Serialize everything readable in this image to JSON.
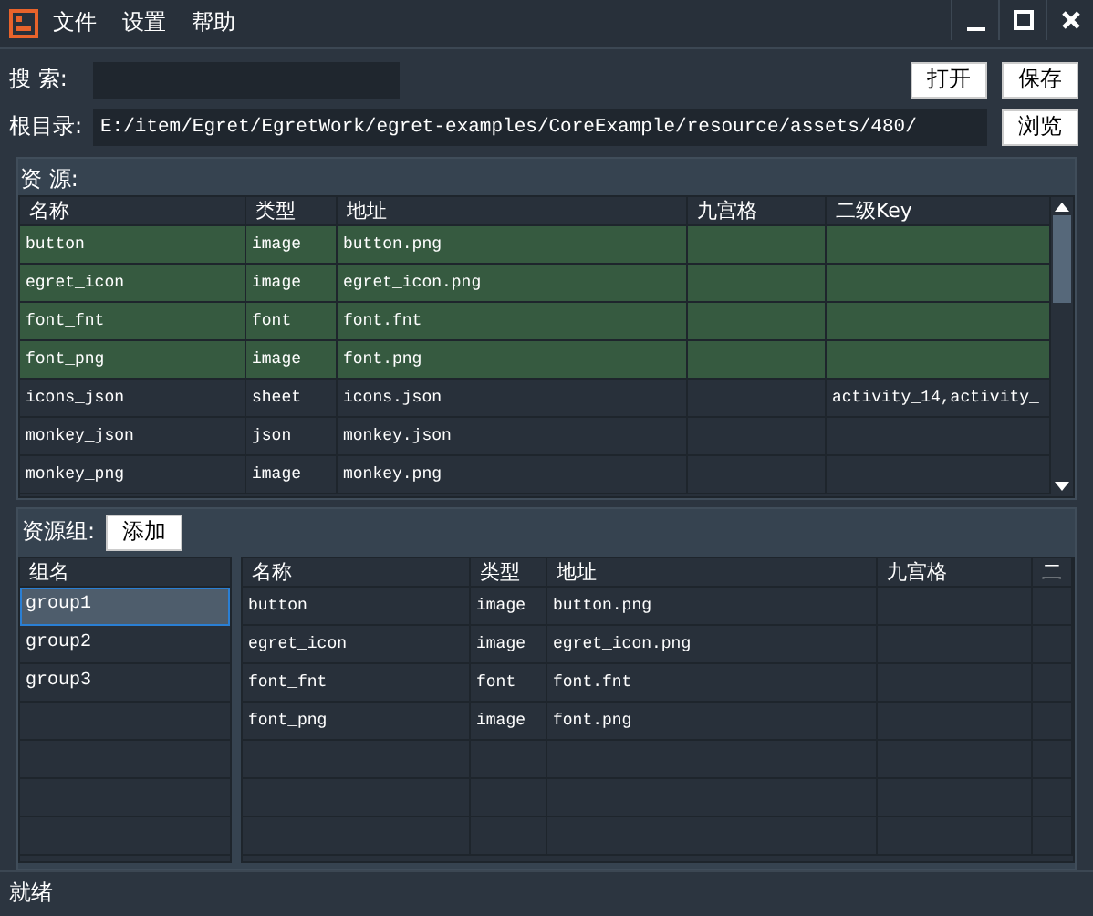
{
  "menu": [
    "文件",
    "设置",
    "帮助"
  ],
  "search": {
    "label": "搜  索:"
  },
  "buttons_top": [
    "打开",
    "保存"
  ],
  "root": {
    "label": "根目录:",
    "value": "E:/item/Egret/EgretWork/egret-examples/CoreExample/resource/assets/480/",
    "button": "浏览"
  },
  "resources": {
    "title": "资  源:",
    "columns": [
      "名称",
      "类型",
      "地址",
      "九宫格",
      "二级Key"
    ],
    "rows": [
      {
        "name": "button",
        "type": "image",
        "url": "button.png",
        "selected": true
      },
      {
        "name": "egret_icon",
        "type": "image",
        "url": "egret_icon.png",
        "selected": true
      },
      {
        "name": "font_fnt",
        "type": "font",
        "url": "font.fnt",
        "selected": true
      },
      {
        "name": "font_png",
        "type": "image",
        "url": "font.png",
        "selected": true
      },
      {
        "name": "icons_json",
        "type": "sheet",
        "url": "icons.json",
        "key": "activity_14,activity_",
        "selected": false
      },
      {
        "name": "monkey_json",
        "type": "json",
        "url": "monkey.json",
        "selected": false
      },
      {
        "name": "monkey_png",
        "type": "image",
        "url": "monkey.png",
        "selected": false
      }
    ]
  },
  "groups": {
    "title": "资源组:",
    "add_button": "添加",
    "list_header": "组名",
    "items": [
      {
        "name": "group1",
        "selected": true
      },
      {
        "name": "group2",
        "selected": false
      },
      {
        "name": "group3",
        "selected": false
      }
    ],
    "columns": [
      "名称",
      "类型",
      "地址",
      "九宫格",
      "二"
    ],
    "rows": [
      {
        "name": "button",
        "type": "image",
        "url": "button.png"
      },
      {
        "name": "egret_icon",
        "type": "image",
        "url": "egret_icon.png"
      },
      {
        "name": "font_fnt",
        "type": "font",
        "url": "font.fnt"
      },
      {
        "name": "font_png",
        "type": "image",
        "url": "font.png"
      }
    ]
  },
  "status_bar": "就绪"
}
